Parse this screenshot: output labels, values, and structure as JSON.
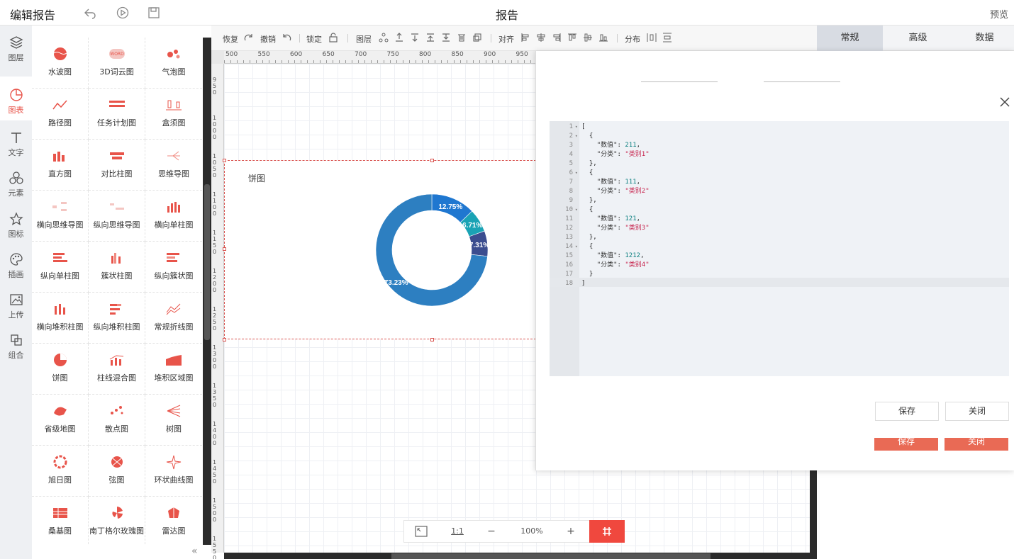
{
  "header": {
    "app_title": "编辑报告",
    "page_title": "报告",
    "preview": "预览"
  },
  "rail": [
    {
      "label": "图层",
      "icon": "layers-icon"
    },
    {
      "label": "图表",
      "icon": "chart-icon",
      "active": true
    },
    {
      "label": "文字",
      "icon": "text-icon"
    },
    {
      "label": "元素",
      "icon": "shapes-icon"
    },
    {
      "label": "图标",
      "icon": "star-icon"
    },
    {
      "label": "插画",
      "icon": "palette-icon"
    },
    {
      "label": "上传",
      "icon": "upload-icon"
    },
    {
      "label": "组合",
      "icon": "group-icon"
    }
  ],
  "components": [
    "水波图",
    "3D词云图",
    "气泡图",
    "路径图",
    "任务计划图",
    "盒须图",
    "直方图",
    "对比柱图",
    "思维导图",
    "横向思维导图",
    "纵向思维导图",
    "横向单柱图",
    "纵向单柱图",
    "簇状柱图",
    "纵向簇状图",
    "横向堆积柱图",
    "纵向堆积柱图",
    "常规折线图",
    "饼图",
    "柱线混合图",
    "堆积区域图",
    "省级地图",
    "散点图",
    "树图",
    "旭日图",
    "弦图",
    "环状曲线图",
    "桑基图",
    "南丁格尔玫瑰图",
    "雷达图"
  ],
  "toolbar": {
    "redo": "恢复",
    "undo": "撤销",
    "lock": "锁定",
    "layer": "图层",
    "align": "对齐",
    "distribute": "分布"
  },
  "right_tabs": [
    "常规",
    "高级",
    "数据"
  ],
  "ruler_top": [
    "500",
    "550",
    "600",
    "650",
    "700",
    "750",
    "800",
    "850",
    "900",
    "950"
  ],
  "ruler_left": [
    "950",
    "1000",
    "1050",
    "1100",
    "1150",
    "1200",
    "1250",
    "1300",
    "1350",
    "1400",
    "1450",
    "1500",
    "1550"
  ],
  "chart": {
    "title": "饼图"
  },
  "chart_data": {
    "type": "pie",
    "title": "饼图",
    "categories": [
      "类别1",
      "类别2",
      "类别3",
      "类别4"
    ],
    "values": [
      211,
      111,
      121,
      1212
    ],
    "labels": [
      "12.75%",
      "6.71%",
      "7.31%",
      "73.23%"
    ],
    "colors": [
      "#1f77d0",
      "#1aa3b5",
      "#3b4d8f",
      "#2d7fc1"
    ]
  },
  "zoom": {
    "ratio": "1:1",
    "minus": "−",
    "level": "100%",
    "plus": "+"
  },
  "dialog": {
    "code_lines": [
      {
        "n": "1",
        "fold": true,
        "html": "["
      },
      {
        "n": "2",
        "fold": true,
        "html": "  {"
      },
      {
        "n": "3",
        "html": "    \"数值\": 211,"
      },
      {
        "n": "4",
        "html": "    \"分类\": \"类别1\""
      },
      {
        "n": "5",
        "html": "  },"
      },
      {
        "n": "6",
        "fold": true,
        "html": "  {"
      },
      {
        "n": "7",
        "html": "    \"数值\": 111,"
      },
      {
        "n": "8",
        "html": "    \"分类\": \"类别2\""
      },
      {
        "n": "9",
        "html": "  },"
      },
      {
        "n": "10",
        "fold": true,
        "html": "  {"
      },
      {
        "n": "11",
        "html": "    \"数值\": 121,"
      },
      {
        "n": "12",
        "html": "    \"分类\": \"类别3\""
      },
      {
        "n": "13",
        "html": "  },"
      },
      {
        "n": "14",
        "fold": true,
        "html": "  {"
      },
      {
        "n": "15",
        "html": "    \"数值\": 1212,"
      },
      {
        "n": "16",
        "html": "    \"分类\": \"类别4\""
      },
      {
        "n": "17",
        "html": "  }"
      },
      {
        "n": "18",
        "html": "]"
      }
    ],
    "save": "保存",
    "close": "关闭",
    "save2": "保存",
    "close2": "关闭"
  }
}
